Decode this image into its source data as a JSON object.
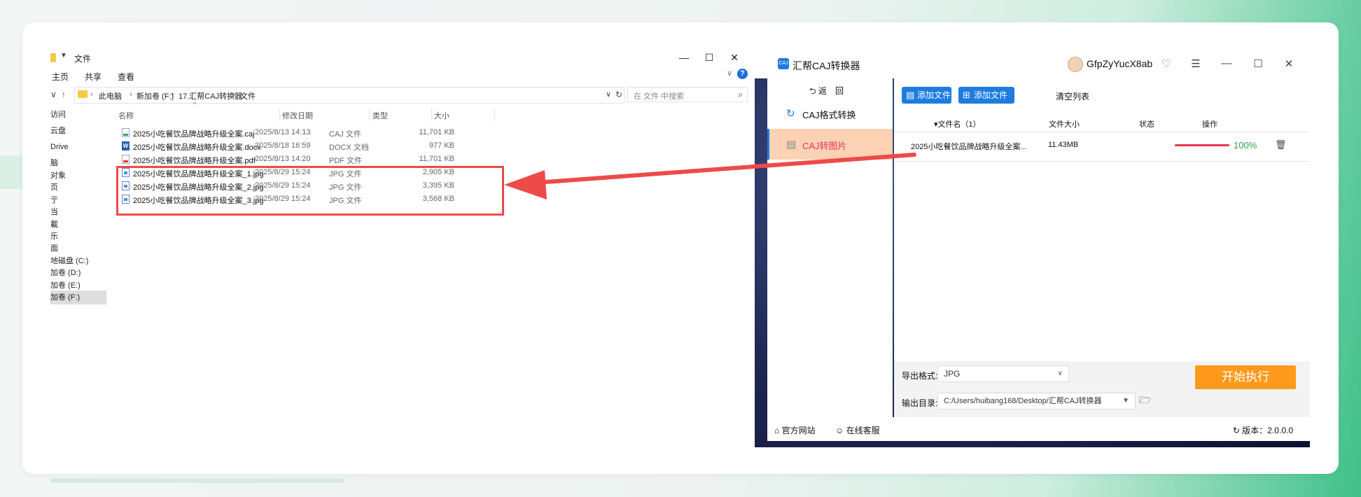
{
  "explorer": {
    "title": "文件",
    "quick_access": "▼",
    "ribbon_tabs": [
      "主页",
      "共享",
      "查看"
    ],
    "help": "?",
    "window_controls": {
      "minimize": "—",
      "maximize": "☐",
      "close": "✕"
    },
    "nav": {
      "back": "∨",
      "up": "↑"
    },
    "breadcrumb": [
      "此电脑",
      "新加卷 (F:)",
      "17.汇帮CAJ转换器",
      "文件"
    ],
    "search_placeholder": "在 文件 中搜索",
    "nav_pane": [
      "访问",
      "云盘",
      "Drive",
      "脑",
      "对象",
      "页",
      "亍",
      "当",
      "載",
      "乐",
      "面",
      "地磁盘 (C:)",
      "加卷 (D:)",
      "加卷 (E:)",
      "加卷 (F:)"
    ],
    "columns": {
      "name": "名称",
      "date": "修改日期",
      "type": "类型",
      "size": "大小"
    },
    "files": [
      {
        "name": "2025小吃餐饮品牌战略升级全案.caj",
        "date": "2025/8/13 14:13",
        "type": "CAJ 文件",
        "size": "11,701 KB",
        "icon": "caj"
      },
      {
        "name": "2025小吃餐饮品牌战略升级全案.docx",
        "date": "2025/8/18 16:59",
        "type": "DOCX 文档",
        "size": "977 KB",
        "icon": "docx"
      },
      {
        "name": "2025小吃餐饮品牌战略升级全案.pdf",
        "date": "2025/8/13 14:20",
        "type": "PDF 文件",
        "size": "11,701 KB",
        "icon": "pdf"
      },
      {
        "name": "2025小吃餐饮品牌战略升级全案_1.jpg",
        "date": "2025/8/29 15:24",
        "type": "JPG 文件",
        "size": "2,905 KB",
        "icon": "jpg"
      },
      {
        "name": "2025小吃餐饮品牌战略升级全案_2.jpg",
        "date": "2025/8/29 15:24",
        "type": "JPG 文件",
        "size": "3,395 KB",
        "icon": "jpg"
      },
      {
        "name": "2025小吃餐饮品牌战略升级全案_3.jpg",
        "date": "2025/8/29 15:24",
        "type": "JPG 文件",
        "size": "3,568 KB",
        "icon": "jpg"
      }
    ]
  },
  "app": {
    "title": "汇帮CAJ转换器",
    "logo_text": "CAJ",
    "user": "GfpZyYucX8ab",
    "controls": {
      "menu": "☰",
      "minimize": "—",
      "maximize": "☐",
      "close": "✕"
    },
    "back_label": "⮌ 返　回",
    "sidebar": [
      {
        "label": "CAJ格式转换",
        "icon": "↻"
      },
      {
        "label": "CAJ转图片",
        "icon": "▤"
      }
    ],
    "toolbar": {
      "add_file": "添加文件",
      "add_folder": "添加文件夹",
      "clear": "清空列表"
    },
    "table": {
      "headers": {
        "name": "▾文件名（1）",
        "size": "文件大小",
        "status": "状态",
        "action": "操作"
      },
      "rows": [
        {
          "name": "2025小吃餐饮品牌战略升级全案...",
          "size": "11.43MB",
          "progress": 1.0,
          "percent": "100%"
        }
      ]
    },
    "export_format_label": "导出格式:",
    "export_format": "JPG",
    "output_dir_label": "输出目录:",
    "output_dir": "C:/Users/huibang168/Desktop/汇帮CAJ转换器",
    "start_button": "开始执行",
    "footer": {
      "website": "官方网站",
      "support": "在线客服",
      "version": "版本：2.0.0.0"
    }
  },
  "colors": {
    "accent_blue": "#1e7ce0",
    "highlight_red": "#ee4a4a",
    "start_orange": "#ff9a1c",
    "progress_red": "#e8334f",
    "percent_green": "#27a844"
  }
}
